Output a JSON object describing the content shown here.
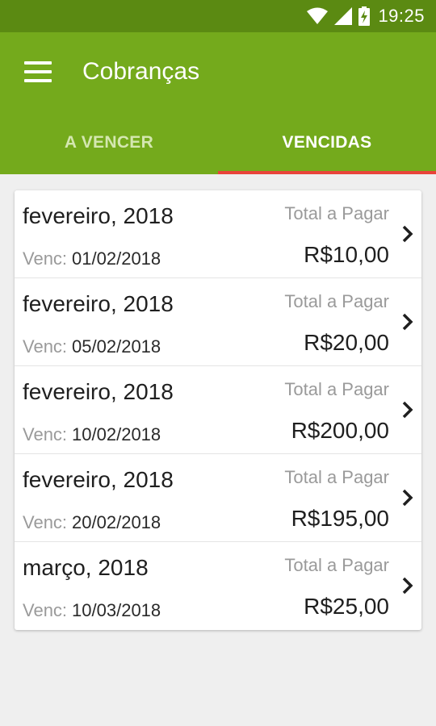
{
  "status_bar": {
    "time": "19:25",
    "icons": [
      "wifi-icon",
      "signal-icon",
      "battery-charging-icon"
    ]
  },
  "app_bar": {
    "title": "Cobranças",
    "menu_icon": "hamburger-menu-icon",
    "color": "#74aa1c"
  },
  "tabs": [
    {
      "label": "A VENCER",
      "active": false
    },
    {
      "label": "VENCIDAS",
      "active": true
    }
  ],
  "accent_color": "#e8433a",
  "list": {
    "items": [
      {
        "month": "fevereiro, 2018",
        "venc_label": "Venc:",
        "venc_date": "01/02/2018",
        "total_label": "Total a Pagar",
        "amount": "R$10,00"
      },
      {
        "month": "fevereiro, 2018",
        "venc_label": "Venc:",
        "venc_date": "05/02/2018",
        "total_label": "Total a Pagar",
        "amount": "R$20,00"
      },
      {
        "month": "fevereiro, 2018",
        "venc_label": "Venc:",
        "venc_date": "10/02/2018",
        "total_label": "Total a Pagar",
        "amount": "R$200,00"
      },
      {
        "month": "fevereiro, 2018",
        "venc_label": "Venc:",
        "venc_date": "20/02/2018",
        "total_label": "Total a Pagar",
        "amount": "R$195,00"
      },
      {
        "month": "março, 2018",
        "venc_label": "Venc:",
        "venc_date": "10/03/2018",
        "total_label": "Total a Pagar",
        "amount": "R$25,00"
      }
    ]
  }
}
